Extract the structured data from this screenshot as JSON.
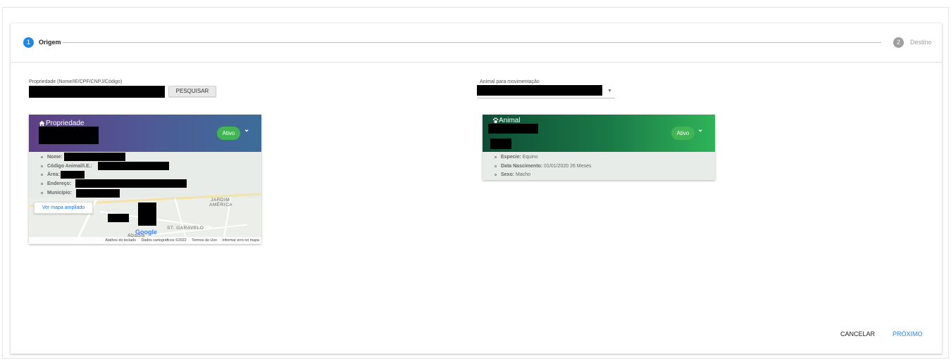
{
  "stepper": {
    "step1_number": "1",
    "step1_label": "Origem",
    "step2_number": "2",
    "step2_label": "Destino"
  },
  "search": {
    "label": "Propriedade (Nome/IE/CPF/CNPJ/Código)",
    "button_label": "PESQUISAR"
  },
  "animal_select": {
    "label": "Animal para movimentação",
    "arrow": "▼"
  },
  "property_card": {
    "icon": "home-icon",
    "title": "Propriedade",
    "status": "Ativo",
    "items": [
      {
        "label": "Nome:",
        "value": ""
      },
      {
        "label": "Código Animal/I.E.:",
        "value": ""
      },
      {
        "label": "Área:",
        "value": ""
      },
      {
        "label": "Endereço:",
        "value": ""
      },
      {
        "label": "Município:",
        "value": ""
      }
    ],
    "map": {
      "enlarge_label": "Ver mapa ampliado",
      "labels": [
        "JARDIM",
        "AMÉRICA",
        "ST. GARAVELO",
        "Abadia",
        "Google"
      ],
      "footer": [
        "Atalhos do teclado",
        "Dados cartográficos ©2022",
        "Termos de Uso",
        "Informar erro no mapa"
      ]
    }
  },
  "animal_card": {
    "icon": "paw-icon",
    "title": "Animal",
    "status": "Ativo",
    "items": [
      {
        "label": "Especie:",
        "value": "Equino"
      },
      {
        "label": "Data Nascimento:",
        "value": "01/01/2020 26 Meses"
      },
      {
        "label": "Sexo:",
        "value": "Macho"
      }
    ]
  },
  "actions": {
    "cancel_label": "CANCELAR",
    "next_label": "PRÓXIMO"
  },
  "colors": {
    "primary": "#1e88e5",
    "badge_green": "#43b454",
    "inactive_step": "#9e9e9e"
  }
}
